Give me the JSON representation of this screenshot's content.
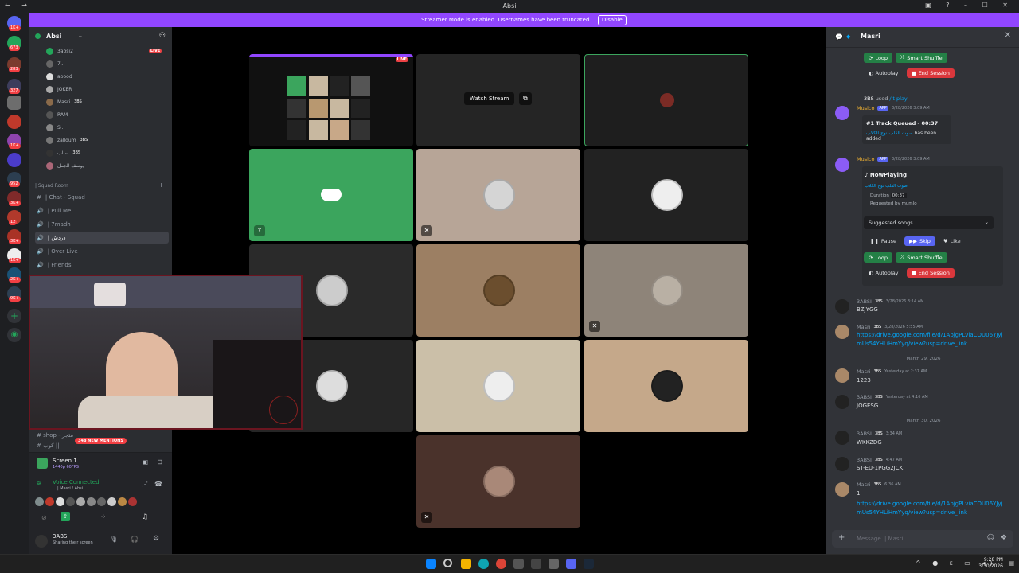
{
  "window": {
    "title": "Absi"
  },
  "banner": {
    "text": "Streamer Mode is enabled. Usernames have been truncated.",
    "button": "Disable"
  },
  "servers": {
    "badges": [
      "1K+",
      "673",
      "283",
      "327",
      "1K+",
      "952",
      "3K+",
      "12",
      "3K+",
      "1K+",
      "2K+",
      "9K+"
    ]
  },
  "sidebar": {
    "server_name": "Absi",
    "voice_users": [
      {
        "name": "3absi2",
        "live": "LIVE"
      },
      {
        "name": "7..."
      },
      {
        "name": "abood"
      },
      {
        "name": "JOKER"
      },
      {
        "name": "Masri",
        "badge": "3BS"
      },
      {
        "name": "RAM"
      },
      {
        "name": "S..."
      },
      {
        "name": "zalloum",
        "badge": "3BS"
      },
      {
        "name": "سناب",
        "badge": "3BS"
      },
      {
        "name": "يوسف الجمل"
      }
    ],
    "category": "| Squad Room",
    "channels": [
      {
        "name": "| Chat - Squad",
        "type": "text"
      },
      {
        "name": "| Pull Me",
        "type": "voice"
      },
      {
        "name": "| 7madh",
        "type": "voice"
      },
      {
        "name": "| دردش",
        "type": "voice",
        "selected": true
      },
      {
        "name": "| Over Live",
        "type": "voice"
      },
      {
        "name": "| Friends",
        "type": "voice"
      }
    ],
    "hidden_channels": [
      "# shop - متجر",
      "# كوب ||"
    ],
    "mentions": "348 NEW MENTIONS"
  },
  "voice_panel": {
    "screen_title": "Screen 1",
    "screen_sub": "1440p 60FPS",
    "status": "Voice Connected",
    "location": "| Masri / Absi"
  },
  "user_panel": {
    "name": "3ABSI",
    "status": "Sharing their screen"
  },
  "stage": {
    "watch_stream": "Watch Stream",
    "live": "LIVE",
    "tile_colors": [
      "#111",
      "#252525",
      "#1e1e1e",
      "#3ba55d",
      "#b7a597",
      "#222",
      "#2a2a2a",
      "#9c7f63",
      "#8e8479",
      "#262626",
      "#cbbfa8",
      "#c5a88a",
      "#4a322b"
    ]
  },
  "chat": {
    "channel_name": "Masri",
    "controls_top": {
      "loop": "Loop",
      "smart_shuffle": "Smart Shuffle",
      "autoplay": "Autoplay",
      "end_session": "End Session"
    },
    "used_play": {
      "name": "3BS",
      "text": "used",
      "cmd": "/it play"
    },
    "bot_name": "Musico",
    "app_tag": "APP",
    "msg1": {
      "time": "3/28/2026 3:09 AM",
      "title": "#1 Track Queued - 00:37",
      "song": "صوت القلب نوح الكلاب",
      "suffix": " has been added"
    },
    "msg2": {
      "time": "3/28/2026 3:09 AM",
      "title": "NowPlaying",
      "song": "صوت القلب نوح الكلاب",
      "duration_label": "Duration",
      "duration": "00:37",
      "requested": "Requested by mumlo",
      "suggested": "Suggested songs",
      "pause": "Pause",
      "skip": "Skip",
      "like": "Like",
      "loop": "Loop",
      "smart_shuffle": "Smart Shuffle",
      "autoplay": "Autoplay",
      "end_session": "End Session"
    },
    "messages": [
      {
        "name": "3ABSI",
        "badge": "3BS",
        "time": "3/28/2026 3:14 AM",
        "text": "BZJYGG"
      },
      {
        "name": "Masri",
        "badge": "3BS",
        "time": "3/28/2026 5:55 AM",
        "link1": "https://drive.google.com/file/d/1ApjgPLviaCOU06YJyj",
        "link2": "mUs54YHLiHmYyq/view?usp=drive_link"
      },
      {
        "divider": "March 29, 2026"
      },
      {
        "name": "Masri",
        "badge": "3BS",
        "time": "Yesterday at 2:37 AM",
        "text": "1223"
      },
      {
        "name": "3ABSI",
        "badge": "3BS",
        "time": "Yesterday at 4:16 AM",
        "text": "JOGESG"
      },
      {
        "divider": "March 30, 2026"
      },
      {
        "name": "3ABSI",
        "badge": "3BS",
        "time": "3:34 AM",
        "text": "WKKZDG"
      },
      {
        "name": "3ABSI",
        "badge": "3BS",
        "time": "4:47 AM",
        "text": "ST-EU-1PGG2JCK"
      },
      {
        "name": "Masri",
        "badge": "3BS",
        "time": "6:36 AM",
        "text": "1",
        "link1": "https://drive.google.com/file/d/1ApjgPLviaCOU06YJyj",
        "link2": "mUs54YHLiHmYyq/view?usp=drive_link"
      }
    ],
    "input_placeholder": "Message",
    "input_target": "| Masri"
  },
  "taskbar": {
    "time": "9:28 PM",
    "date": "3/30/2026"
  }
}
